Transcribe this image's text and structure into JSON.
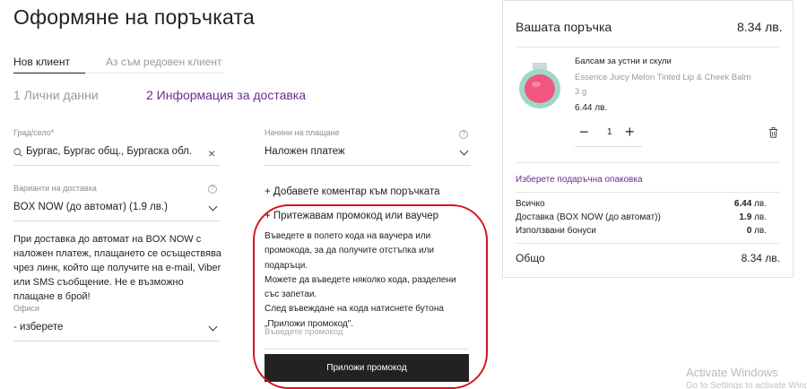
{
  "page_title": "Оформяне на поръчката",
  "tabs": {
    "new_client": "Нов клиент",
    "registered_client": "Аз съм редовен клиент"
  },
  "steps": {
    "step1": "1  Лични данни",
    "step2": "2  Информация за доставка"
  },
  "city": {
    "label": "Град/село*",
    "value": "Бургас, Бургас общ., Бургаска обл."
  },
  "delivery": {
    "label": "Варианти на доставка",
    "value": "BOX NOW (до автомат) (1.9 лв.)",
    "help": "?"
  },
  "delivery_note": "При доставка до автомат на BOX NOW с наложен платеж, плащането се осъществява чрез линк, който ще получите на e-mail, Viber или SMS съобщение. Не е възможно плащане в брой!",
  "offices": {
    "label": "Офиси",
    "value": "- изберете"
  },
  "payment": {
    "label": "Начини на плащане",
    "value": "Наложен платеж",
    "help": "?"
  },
  "comment_link": "+ Добавете коментар към поръчката",
  "promo": {
    "toggle": "+ Притежавам промокод или ваучер",
    "text1": "Въведете в полето кода на ваучера или промокода, за да получите отстъпка или подаръци.",
    "text2": "Можете да въведете няколко кода, разделени със запетаи.",
    "text3": "След въвеждане на кода натиснете бутона „Приложи промокод\".",
    "placeholder": "Въведете промокод",
    "button": "Приложи промокод"
  },
  "summary": {
    "title": "Вашата поръчка",
    "total_top": "8.34 лв.",
    "product": {
      "name": "Балсам за устни и скули",
      "desc": "Essence Juicy Melon Tinted Lip & Cheek Balm",
      "size": "3 g",
      "price": "6.44 лв.",
      "qty": "1",
      "minus": "−",
      "plus": "+"
    },
    "gift_link": "Изберете подаръчна опаковка",
    "rows": [
      {
        "label": "Всичко",
        "value_bold": "6.44",
        "unit": " лв."
      },
      {
        "label": "Доставка (BOX NOW (до автомат))",
        "value_bold": "1.9",
        "unit": " лв."
      },
      {
        "label": "Използвани бонуси",
        "value_bold": "0",
        "unit": " лв."
      }
    ],
    "grand_label": "Общо",
    "grand_value": "8.34 лв."
  },
  "watermark": {
    "line1": "Activate Windows",
    "line2": "Go to Settings to activate Windows."
  },
  "colors": {
    "accent": "#6b2d8f",
    "highlight": "#d3141c",
    "button": "#222222"
  }
}
